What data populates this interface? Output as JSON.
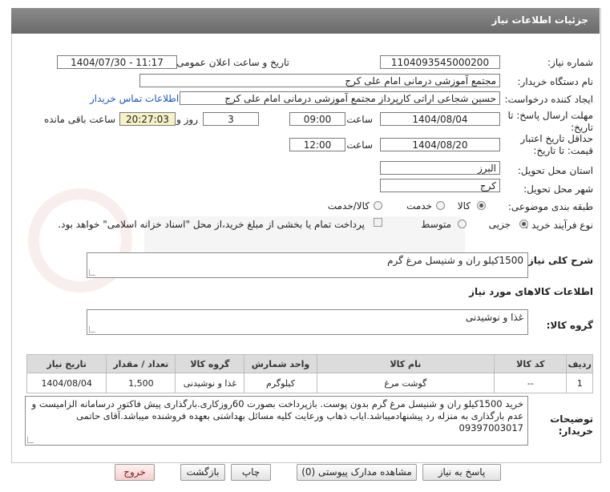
{
  "header": {
    "title": "جزئیات اطلاعات نیاز"
  },
  "fields": {
    "need_number_label": "شماره نیاز:",
    "need_number": "1104093545000200",
    "announce_label": "تاریخ و ساعت اعلان عمومی:",
    "announce_value": "1404/07/30 - 11:17",
    "buyer_org_label": "نام دستگاه خریدار:",
    "buyer_org": "مجتمع آموزشی درمانی امام علی کرج",
    "requester_label": "ایجاد کننده درخواست:",
    "requester": "حسین شجاعی اراتی کارپرداز مجتمع آموزشی درمانی امام علی کرج",
    "contact_link": "اطلاعات تماس خریدار",
    "deadline_label_1": "مهلت ارسال پاسخ: تا",
    "deadline_label_2": "تاریخ:",
    "deadline_date": "1404/08/04",
    "time_label": "ساعت",
    "deadline_time": "09:00",
    "days_value": "3",
    "days_label": "روز و",
    "remaining_time": "20:27:03",
    "remaining_label": "ساعت باقی مانده",
    "validity_label_1": "حداقل تاریخ اعتبار",
    "validity_label_2": "قیمت: تا تاریخ:",
    "validity_date": "1404/08/20",
    "validity_time": "12:00",
    "province_label": "استان محل تحویل:",
    "province": "البرز",
    "city_label": "شهر محل تحویل:",
    "city": "کرج",
    "category_label": "طبقه بندی موضوعی:",
    "category_options": [
      "کالا",
      "خدمت",
      "کالا/خدمت"
    ],
    "process_label": "نوع فرآیند خرید :",
    "process_options": [
      "جزیی",
      "متوسط"
    ],
    "payment_note": "پرداخت تمام یا بخشی از مبلغ خرید،از محل \"اسناد خزانه اسلامی\" خواهد بود."
  },
  "summary": {
    "label": "شرح کلی نیاز:",
    "value": "1500کیلو ران و شنیسل مرغ گرم"
  },
  "goods": {
    "section_title": "اطلاعات کالاهای مورد نیاز",
    "group_label": "گروه کالا:",
    "group_value": "غذا و نوشیدنی",
    "columns": [
      "ردیف",
      "کد کالا",
      "نام کالا",
      "واحد شمارش",
      "گروه کالا",
      "تعداد / مقدار",
      "تاریخ نیاز"
    ],
    "rows": [
      [
        "1",
        "--",
        "گوشت مرغ",
        "کیلوگرم",
        "غذا و نوشیدنی",
        "1,500",
        "1404/08/04"
      ]
    ]
  },
  "buyer_notes": {
    "label_1": "توضیحات",
    "label_2": "خریدار:",
    "line1": "خرید 1500کیلو ران و شنیسل مرغ گرم بدون پوست. بازپرداخت بصورت 60روزکاری.بارگذاری پیش فاکتور درسامانه الزامیست و",
    "line2": "عدم بارگذاری به منزله رد پیشنهادمیباشد.ایاب ذهاب ورعایت کلیه مسائل بهداشتی بعهده فروشنده میباشد.آقای حاتمی",
    "line3": "09397003017"
  },
  "buttons": {
    "reply": "پاسخ به نیاز",
    "attachments": "مشاهده مدارک پیوستی (0)",
    "print": "چاپ",
    "back": "بازگشت",
    "exit": "خروج"
  }
}
